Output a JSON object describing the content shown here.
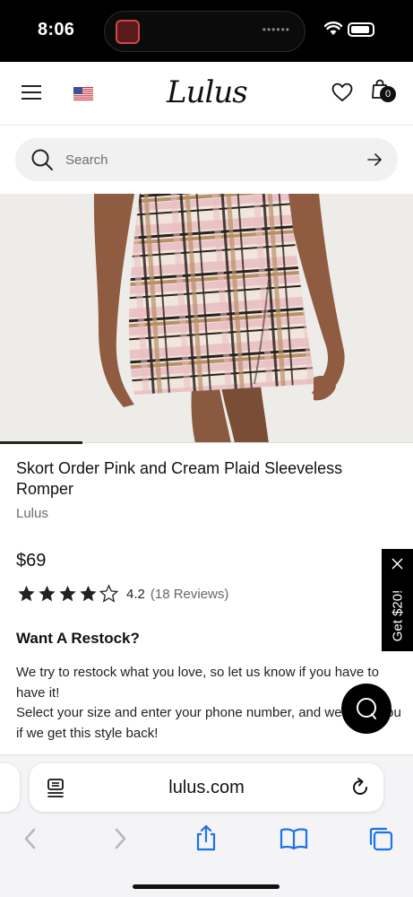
{
  "status_bar": {
    "time": "8:06",
    "island_dots": "••••••"
  },
  "header": {
    "logo": "Lulus",
    "bag_count": "0",
    "icons": [
      "menu-icon",
      "us-flag-icon",
      "heart-icon",
      "shopping-bag-icon"
    ]
  },
  "search": {
    "placeholder": "Search"
  },
  "product": {
    "image_position": "1 of 5",
    "title": "Skort Order Pink and Cream Plaid Sleeveless Romper",
    "brand": "Lulus",
    "price": "$69",
    "rating_value": "4.2",
    "rating_count": "(18 Reviews)",
    "stars_filled": 4,
    "stars_total": 5
  },
  "restock": {
    "heading": "Want A Restock?",
    "line1": "We try to restock what you love, so let us know if you have to have it!",
    "line2": "Select your size and enter your phone number, and we'll text you if we get this style back!"
  },
  "promo_tab": {
    "label": "Get $20!"
  },
  "browser": {
    "url": "lulus.com"
  },
  "colors": {
    "accent": "#000000",
    "search_bg": "#f1f1f1",
    "safari_blue": "#1a73e8"
  }
}
